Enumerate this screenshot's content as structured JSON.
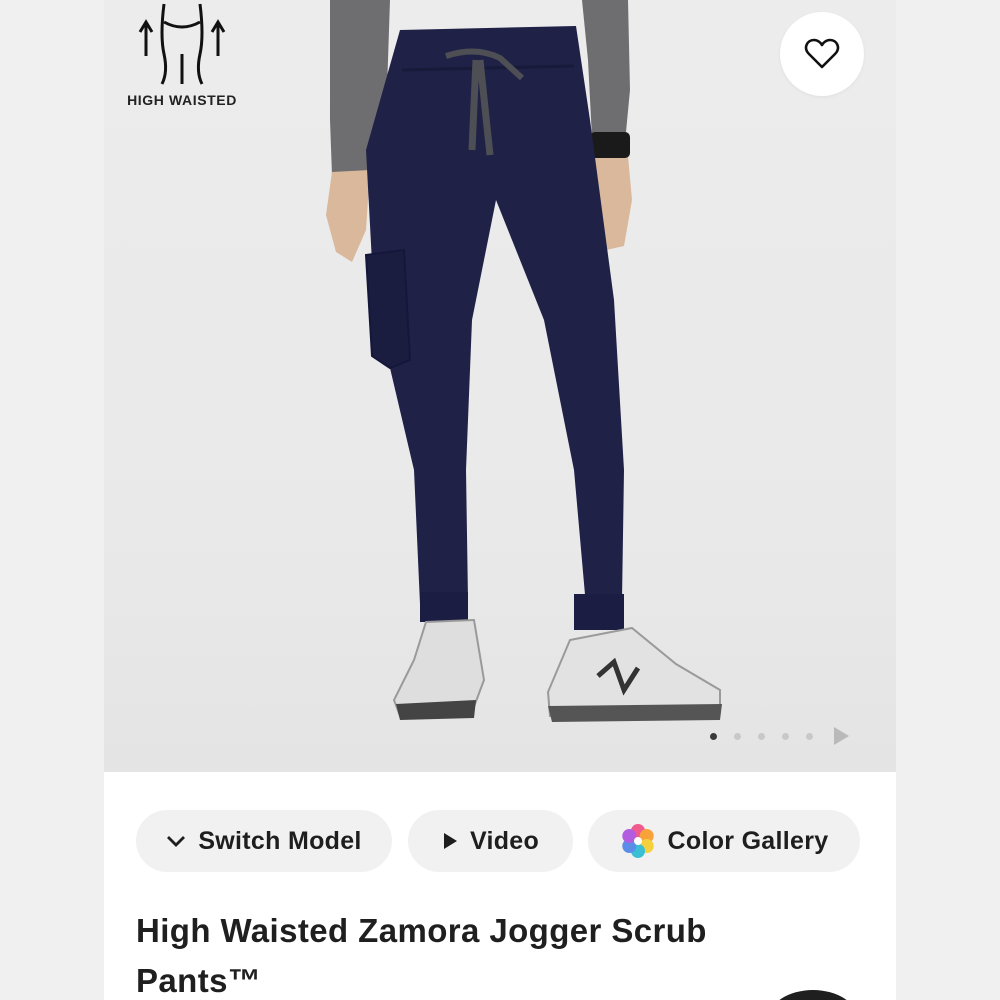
{
  "badge": {
    "label": "HIGH WAISTED",
    "icon": "high-waist-icon"
  },
  "favorite": {
    "icon": "heart-icon"
  },
  "carousel": {
    "total_dots": 5,
    "active_index": 0,
    "next_icon": "play-arrow-icon"
  },
  "actions": {
    "switch_model": {
      "label": "Switch Model",
      "icon": "chevron-down-icon"
    },
    "video": {
      "label": "Video",
      "icon": "play-icon"
    },
    "color_gallery": {
      "label": "Color Gallery",
      "icon": "color-wheel-icon"
    }
  },
  "product": {
    "title": "High Waisted Zamora Jogger Scrub Pants™"
  },
  "colors": {
    "pants": "#1f2147",
    "background": "#ebebeb",
    "pill": "#f1f1f1",
    "text": "#1e1e1e"
  }
}
